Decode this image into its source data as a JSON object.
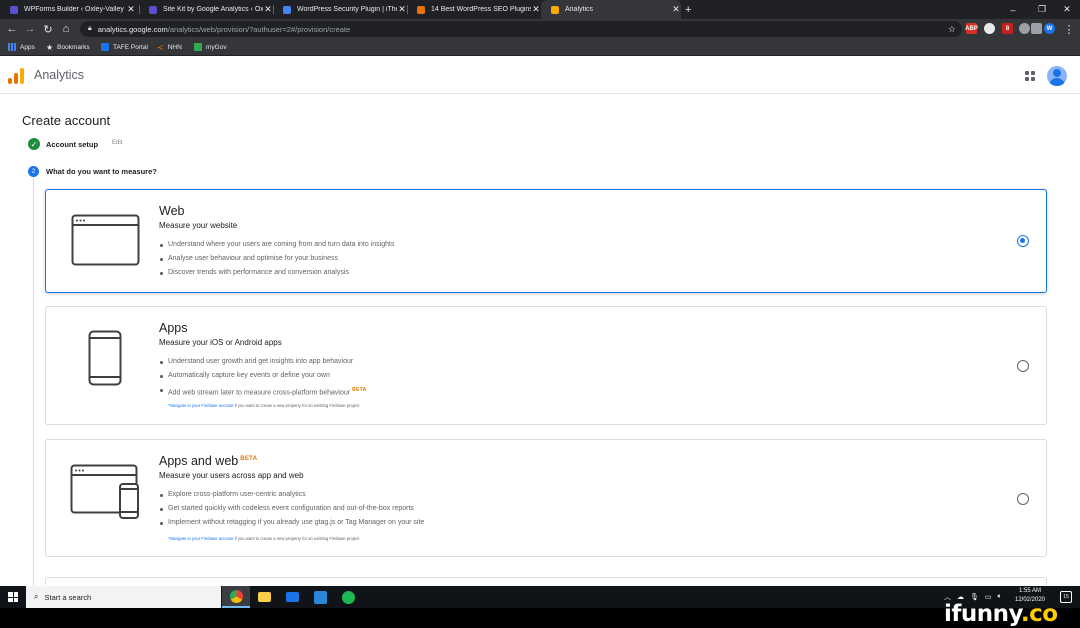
{
  "browser": {
    "tabs": [
      {
        "title": "WPForms Builder ‹ Oxley-Valley",
        "favicon_color": "#5a4fcf"
      },
      {
        "title": "Site Kit by Google Analytics ‹ Ox",
        "favicon_color": "#5a4fcf"
      },
      {
        "title": "WordPress Security Plugin | iThe",
        "favicon_color": "#4285f4"
      },
      {
        "title": "14 Best WordPress SEO Plugins a",
        "favicon_color": "#e8710a"
      },
      {
        "title": "Analytics",
        "favicon_color": "#f9ab00",
        "active": true
      }
    ],
    "new_tab": "+",
    "url_host": "analytics.google.com",
    "url_path": "/analytics/web/provision/?authuser=2#/provision/create",
    "bookmarks": [
      {
        "label": "Apps",
        "icon_color": "#4285f4"
      },
      {
        "label": "Bookmarks",
        "icon_color": "#e8eaed"
      },
      {
        "label": "TAFE Portal",
        "icon_color": "#1a73e8"
      },
      {
        "label": "NHN",
        "icon_color": "#e8710a"
      },
      {
        "label": "myGov",
        "icon_color": "#34a853"
      }
    ],
    "extensions": [
      {
        "label": "ABP",
        "color": "#d93025"
      },
      {
        "label": "",
        "color": "#5f6368"
      },
      {
        "label": "8",
        "color": "#c5221f"
      },
      {
        "label": "",
        "color": "#5f6368"
      },
      {
        "label": "",
        "color": "#5f6368"
      },
      {
        "label": "W",
        "color": "#1a73e8"
      }
    ]
  },
  "app": {
    "title": "Analytics",
    "logo_colors": [
      "#f9ab00",
      "#e37400",
      "#e37400"
    ]
  },
  "page": {
    "title": "Create account",
    "steps": [
      {
        "number": "✓",
        "label": "Account setup",
        "action": "Edit",
        "color": "#1e8e3e"
      },
      {
        "number": "2",
        "label": "What do you want to measure?",
        "color": "#1a73e8"
      }
    ],
    "options": [
      {
        "title": "Web",
        "beta": "",
        "subtitle": "Measure your website",
        "bullets": [
          {
            "text": "Understand where your users are coming from and turn data into insights",
            "beta": ""
          },
          {
            "text": "Analyse user behaviour and optimise for your business",
            "beta": ""
          },
          {
            "text": "Discover trends with performance and conversion analysis",
            "beta": ""
          }
        ],
        "note_link": "",
        "note_text": "",
        "selected": true
      },
      {
        "title": "Apps",
        "beta": "",
        "subtitle": "Measure your iOS or Android apps",
        "bullets": [
          {
            "text": "Understand user growth and get insights into app behaviour",
            "beta": ""
          },
          {
            "text": "Automatically capture key events or define your own",
            "beta": ""
          },
          {
            "text": "Add web stream later to measure cross-platform behaviour",
            "beta": "BETA"
          }
        ],
        "note_link": "*Navigate to your Firebase account",
        "note_text": " if you want to create a new property for an existing Firebase project",
        "selected": false
      },
      {
        "title": "Apps and web",
        "beta": "BETA",
        "subtitle": "Measure your users across app and web",
        "bullets": [
          {
            "text": "Explore cross-platform user-centric analytics",
            "beta": ""
          },
          {
            "text": "Get started quickly with codeless event configuration and out-of-the-box reports",
            "beta": ""
          },
          {
            "text": "Implement without retagging if you already use gtag.js or Tag Manager on your site",
            "beta": ""
          }
        ],
        "note_link": "*Navigate to your Firebase account",
        "note_text": " if you want to create a new property for an existing Firebase project",
        "selected": false
      }
    ]
  },
  "taskbar": {
    "search_placeholder": "Start a search",
    "apps": [
      {
        "name": "chrome",
        "color": "#ea4335",
        "active": true
      },
      {
        "name": "file-explorer",
        "color": "#f9ce4b",
        "active": false
      },
      {
        "name": "mail",
        "color": "#1a73e8",
        "active": false
      },
      {
        "name": "snip",
        "color": "#2b88d8",
        "active": false
      },
      {
        "name": "spotify",
        "color": "#1db954",
        "active": false
      }
    ],
    "time": "1:55 AM",
    "date": "12/02/2020",
    "notifications": "15"
  },
  "watermark": {
    "text": "ifunny",
    "suffix": ".co"
  }
}
